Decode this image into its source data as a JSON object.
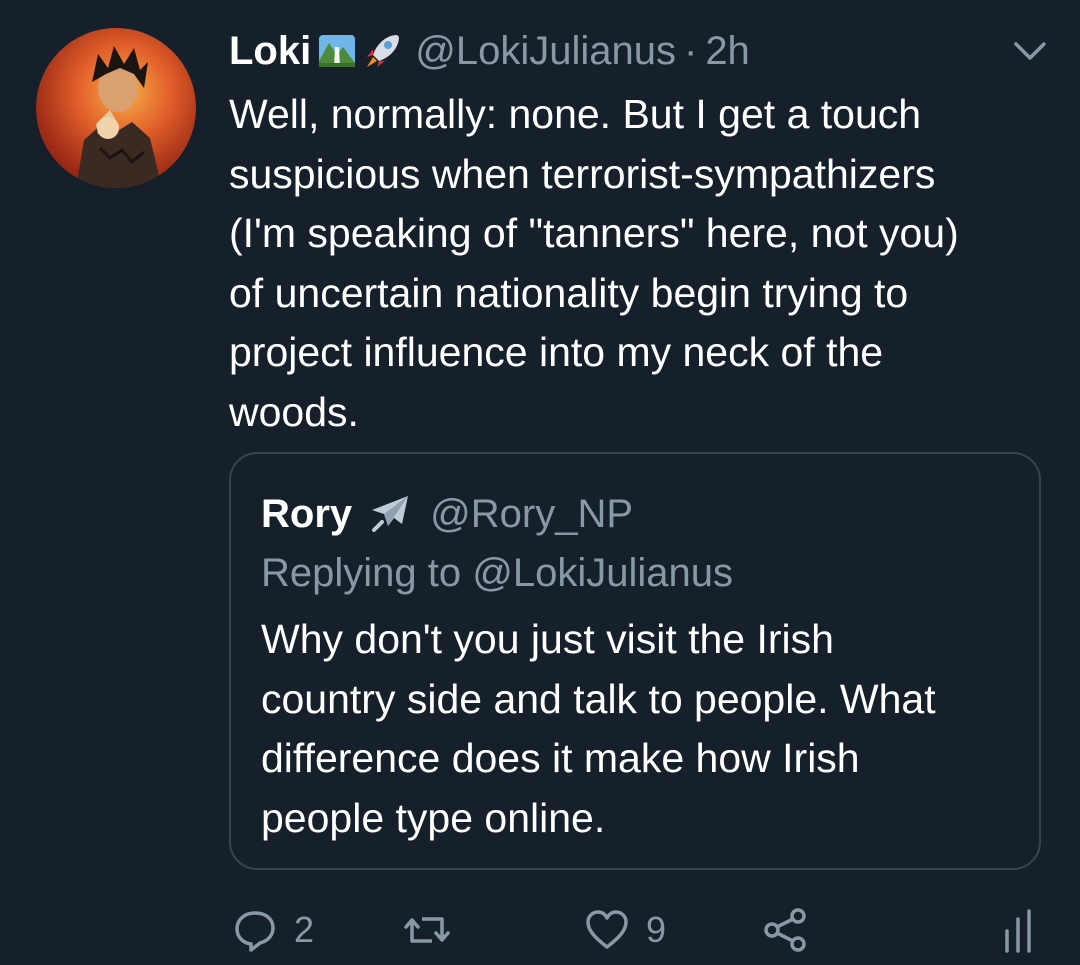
{
  "tweet": {
    "display_name": "Loki",
    "name_emojis": [
      "mountain-waterfall-emoji",
      "rocket-emoji"
    ],
    "handle": "@LokiJulianus",
    "separator": "·",
    "time": "2h",
    "text": "Well, normally: none. But I get a touch\nsuspicious when terrorist-sympathizers\n(I'm speaking of \"tanners\" here, not you)\nof uncertain nationality begin trying to\nproject influence into my neck of the\nwoods."
  },
  "quoted_tweet": {
    "display_name": "Rory",
    "name_emoji": "airplane-emoji",
    "handle": "@Rory_NP",
    "replying_to": "Replying to @LokiJulianus",
    "text": "Why don't you just visit the Irish\ncountry side and talk to people. What\ndifference does it make how Irish\npeople type online."
  },
  "actions": {
    "reply_count": "2",
    "retweet_count": "",
    "like_count": "9"
  },
  "colors": {
    "background": "#15202b",
    "text_primary": "#ffffff",
    "text_secondary": "#8899a6",
    "border": "#38444d"
  }
}
